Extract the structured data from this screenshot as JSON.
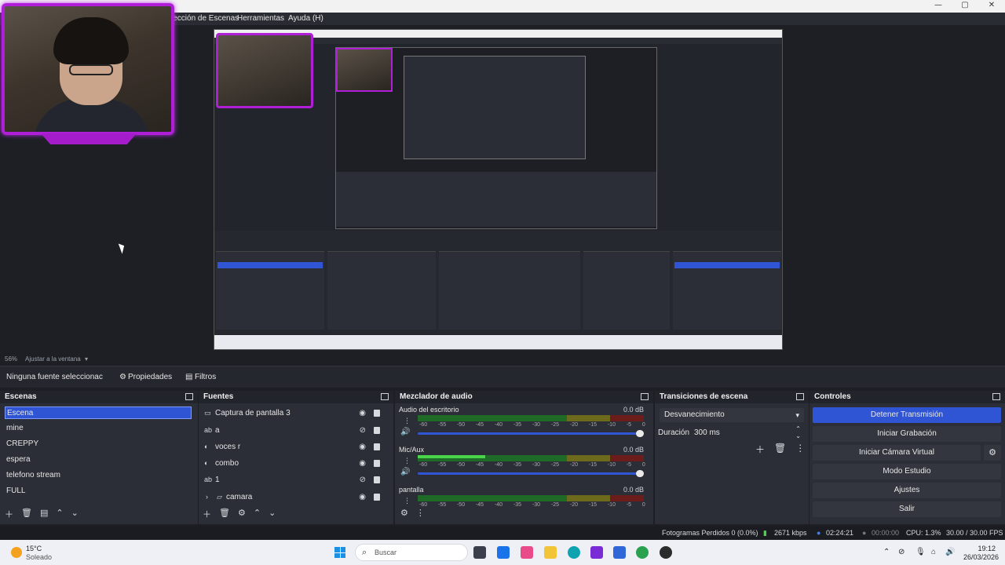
{
  "menubar": {
    "items": [
      "lección de Escenas",
      "Herramientas",
      "Ayuda (H)"
    ]
  },
  "window_controls": [
    "—",
    "▢",
    "✕"
  ],
  "zoom": {
    "value": "56%",
    "mode": "Ajustar a la ventana"
  },
  "context": {
    "no_source": "Ninguna fuente seleccionac",
    "properties": "Propiedades",
    "filters": "Filtros"
  },
  "scenes": {
    "title": "Escenas",
    "items": [
      "Escena",
      "mine",
      "CREPPY",
      "espera",
      "telefono stream",
      "FULL"
    ],
    "selected_index": 0
  },
  "sources": {
    "title": "Fuentes",
    "items": [
      {
        "label": "Captura de pantalla 3",
        "icon": "monitor-icon"
      },
      {
        "label": "a",
        "icon": "text-icon"
      },
      {
        "label": "voces r",
        "icon": "audio-icon"
      },
      {
        "label": "combo",
        "icon": "audio-icon"
      },
      {
        "label": "1",
        "icon": "text-icon"
      },
      {
        "label": "camara",
        "icon": "folder-icon"
      }
    ]
  },
  "mixer": {
    "title": "Mezclador de audio",
    "tracks": [
      {
        "name": "Audio del escritorio",
        "db": "0.0 dB",
        "level": 0.0
      },
      {
        "name": "Mic/Aux",
        "db": "0.0 dB",
        "level": 0.3
      },
      {
        "name": "pantalla",
        "db": "0.0 dB",
        "level": 0.0
      }
    ],
    "ticks": [
      "-60",
      "-55",
      "-50",
      "-45",
      "-40",
      "-35",
      "-30",
      "-25",
      "-20",
      "-15",
      "-10",
      "-5",
      "0"
    ]
  },
  "transitions": {
    "title": "Transiciones de escena",
    "selected": "Desvanecimiento",
    "duration_label": "Duración",
    "duration_value": "300 ms"
  },
  "controls": {
    "title": "Controles",
    "buttons": [
      "Detener Transmisión",
      "Iniciar Grabación",
      "Iniciar Cámara Virtual",
      "Modo Estudio",
      "Ajustes",
      "Salir"
    ],
    "active_index": 0
  },
  "status": {
    "frames": "Fotogramas Perdidos 0 (0.0%)",
    "bitrate": "2671 kbps",
    "live_time": "02:24:21",
    "rec_time": "00:00:00",
    "cpu": "CPU: 1.3%",
    "fps": "30.00 / 30.00 FPS"
  },
  "taskbar": {
    "weather_temp": "15°C",
    "weather_desc": "Soleado",
    "search_placeholder": "Buscar",
    "time": "19:12",
    "date": "26/03/2026"
  },
  "colors": {
    "accent": "#2f55d4",
    "webcam_border": "#b01ed8",
    "meter_green": "#49d449"
  }
}
